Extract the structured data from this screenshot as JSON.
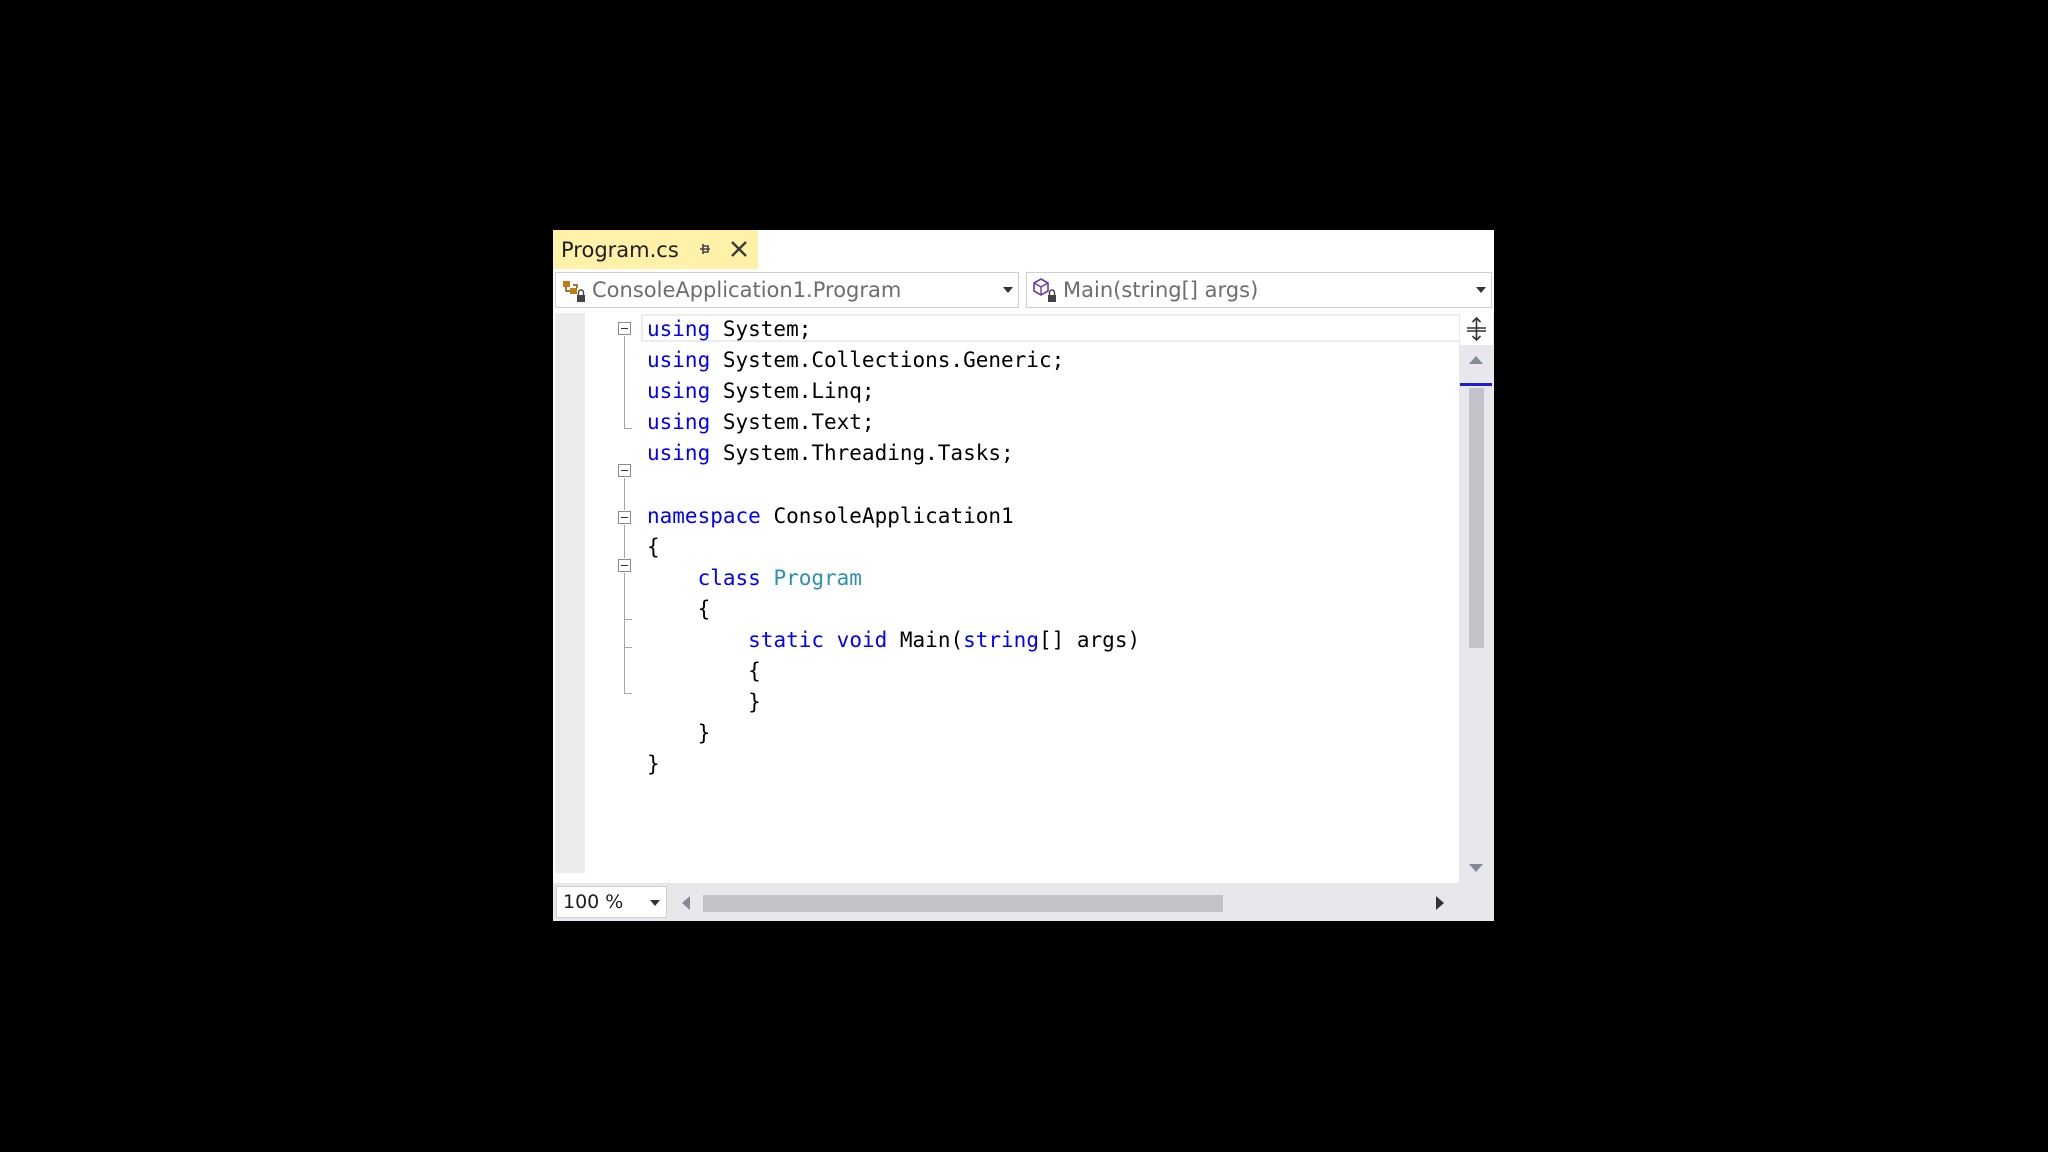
{
  "tab": {
    "title": "Program.cs"
  },
  "navbar": {
    "type_dropdown": "ConsoleApplication1.Program",
    "member_dropdown": "Main(string[] args)"
  },
  "code_lines": [
    [
      {
        "t": "using",
        "c": "kw"
      },
      {
        "t": " System;"
      }
    ],
    [
      {
        "t": "using",
        "c": "kw"
      },
      {
        "t": " System.Collections.Generic;"
      }
    ],
    [
      {
        "t": "using",
        "c": "kw"
      },
      {
        "t": " System.Linq;"
      }
    ],
    [
      {
        "t": "using",
        "c": "kw"
      },
      {
        "t": " System.Text;"
      }
    ],
    [
      {
        "t": "using",
        "c": "kw"
      },
      {
        "t": " System.Threading.Tasks;"
      }
    ],
    [],
    [
      {
        "t": "namespace",
        "c": "kw"
      },
      {
        "t": " ConsoleApplication1"
      }
    ],
    [
      {
        "t": "{"
      }
    ],
    [
      {
        "t": "    "
      },
      {
        "t": "class",
        "c": "kw"
      },
      {
        "t": " "
      },
      {
        "t": "Program",
        "c": "ty"
      }
    ],
    [
      {
        "t": "    {"
      }
    ],
    [
      {
        "t": "        "
      },
      {
        "t": "static",
        "c": "kw"
      },
      {
        "t": " "
      },
      {
        "t": "void",
        "c": "kw"
      },
      {
        "t": " Main("
      },
      {
        "t": "string",
        "c": "kw"
      },
      {
        "t": "[] args)"
      }
    ],
    [
      {
        "t": "        {"
      }
    ],
    [
      {
        "t": "        }"
      }
    ],
    [
      {
        "t": "    }"
      }
    ],
    [
      {
        "t": "}"
      }
    ]
  ],
  "zoom": {
    "value": "100 %"
  },
  "colors": {
    "keyword": "#0000ff",
    "type": "#2b91af",
    "tab_active": "#fff1a8"
  },
  "icons": [
    "pin-icon",
    "close-icon",
    "class-icon",
    "method-icon",
    "chevron-down-icon",
    "split-editor-icon",
    "scroll-up-icon",
    "scroll-down-icon",
    "scroll-left-icon",
    "scroll-right-icon"
  ]
}
